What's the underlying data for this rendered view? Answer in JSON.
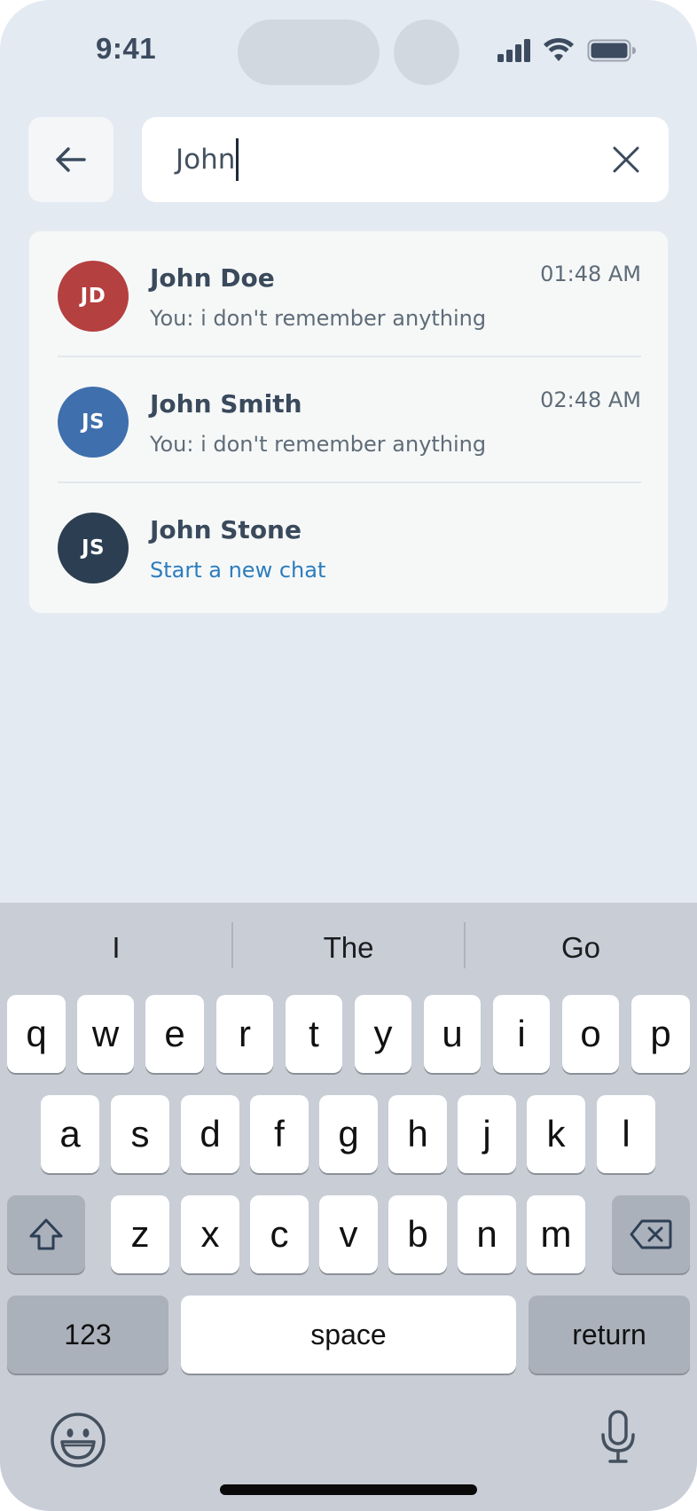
{
  "status_bar": {
    "time": "9:41"
  },
  "search": {
    "value": "John"
  },
  "results": [
    {
      "initials": "JD",
      "name": "John Doe",
      "preview": "You: i don't remember anything",
      "time": "01:48 AM",
      "avatar_color": "#b4403f"
    },
    {
      "initials": "JS",
      "name": "John Smith",
      "preview": "You: i don't remember anything",
      "time": "02:48 AM",
      "avatar_color": "#3f6fad"
    },
    {
      "initials": "JS",
      "name": "John Stone",
      "preview": "Start a new chat",
      "time": "",
      "avatar_color": "#2c3e51"
    }
  ],
  "keyboard": {
    "suggestions": [
      "I",
      "The",
      "Go"
    ],
    "row1": [
      "q",
      "w",
      "e",
      "r",
      "t",
      "y",
      "u",
      "i",
      "o",
      "p"
    ],
    "row2": [
      "a",
      "s",
      "d",
      "f",
      "g",
      "h",
      "j",
      "k",
      "l"
    ],
    "row3": [
      "z",
      "x",
      "c",
      "v",
      "b",
      "n",
      "m"
    ],
    "numbers_label": "123",
    "space_label": "space",
    "return_label": "return"
  },
  "colors": {
    "accent_link": "#2c7dbd",
    "background": "#e4eaf2"
  }
}
